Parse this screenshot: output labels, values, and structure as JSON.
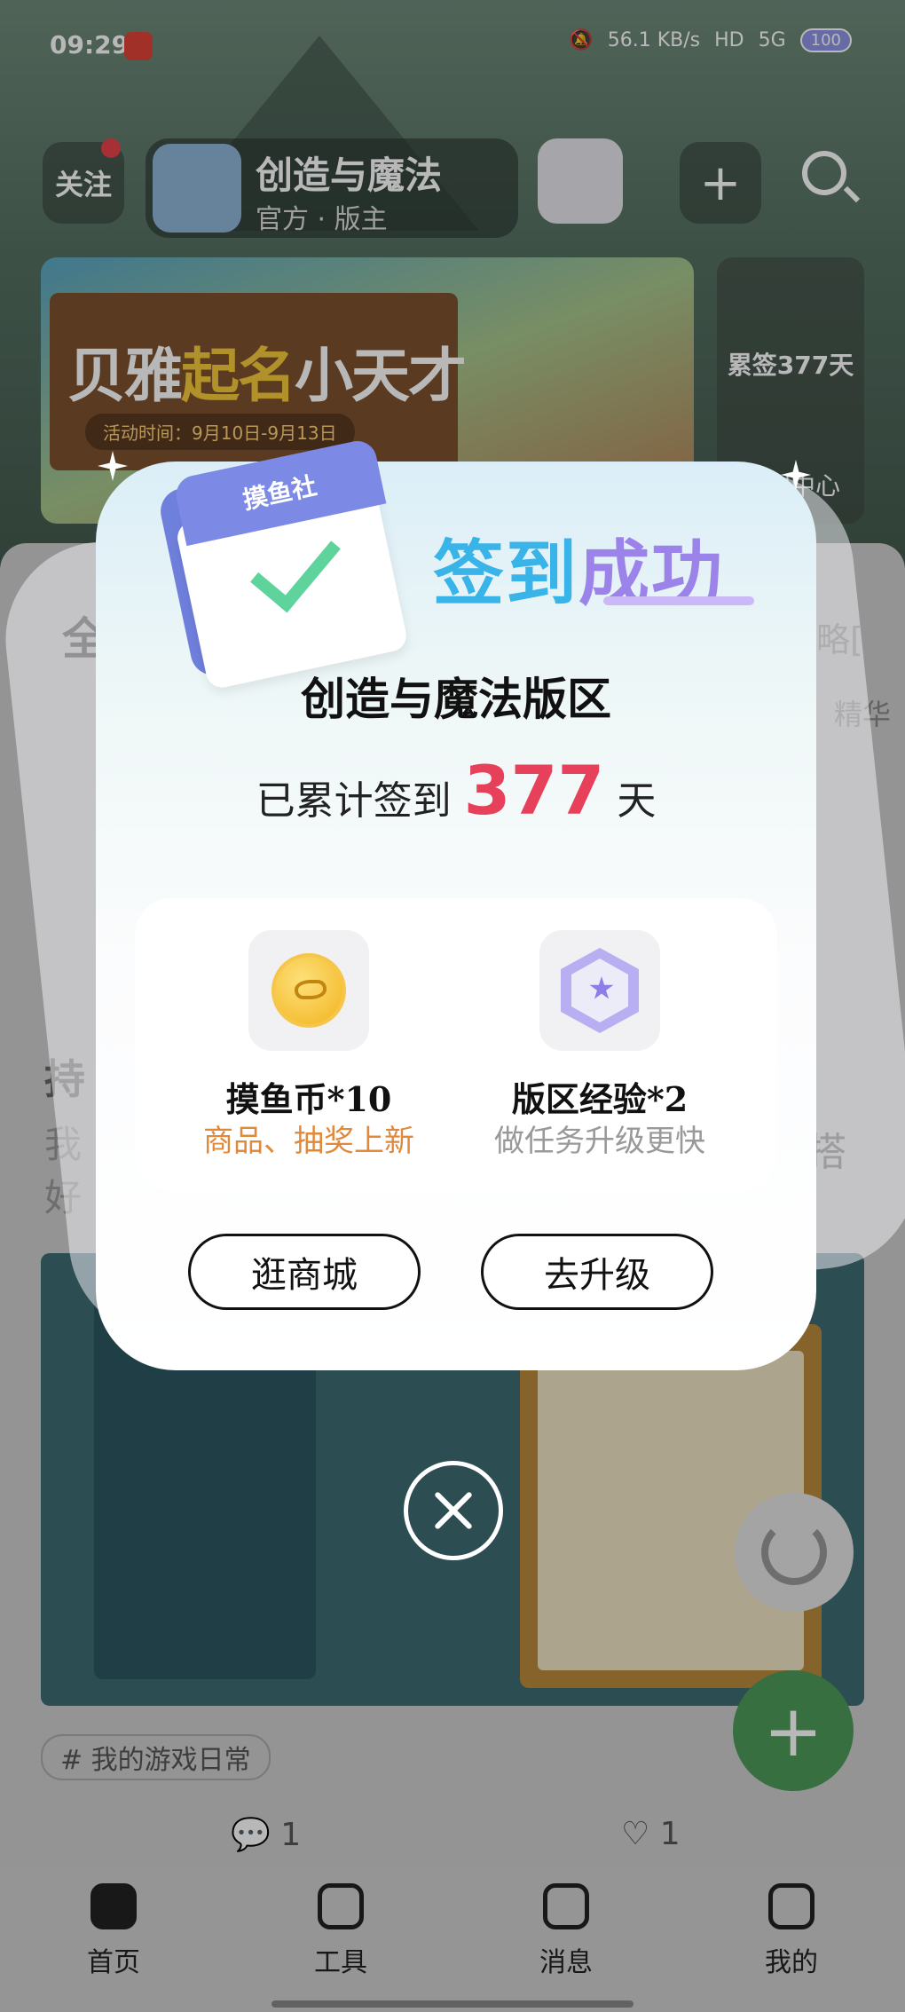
{
  "status_bar": {
    "time": "09:29",
    "net_speed": "56.1 KB/s",
    "hd": "HD",
    "network": "5G",
    "battery": "100"
  },
  "header": {
    "follow_label": "关注",
    "forum_name": "创造与魔法",
    "forum_sub": "官方 · 版主"
  },
  "banner": {
    "title_part1": "贝雅",
    "title_highlight": "起名",
    "title_part2": "小天才",
    "date": "活动时间：9月10日-9月13日"
  },
  "checkin_side": {
    "streak_label": "累签377天",
    "welfare_label": "福利中心"
  },
  "background_text": {
    "left_heading": "全",
    "right_heading": "略[",
    "right_sub": "精华",
    "post_title_fragment": "持",
    "post_body_1": "我",
    "post_body_2": "好",
    "post_right": "搭"
  },
  "post": {
    "tag": "# 我的游戏日常",
    "comments": "1",
    "likes": "1"
  },
  "modal": {
    "calendar_label": "摸鱼社",
    "success_title_1": "签到",
    "success_title_2": "成功",
    "forum_title": "创造与魔法版区",
    "streak_prefix": "已累计签到",
    "streak_days": "377",
    "streak_suffix": "天",
    "rewards": [
      {
        "name": "摸鱼币*10",
        "desc": "商品、抽奖上新",
        "desc_color": "#e0893a",
        "icon": "coin-icon"
      },
      {
        "name": "版区经验*2",
        "desc": "做任务升级更快",
        "desc_color": "#999999",
        "icon": "level-badge-icon"
      }
    ],
    "button_mall": "逛商城",
    "button_upgrade": "去升级"
  },
  "bottom_nav": [
    {
      "label": "首页",
      "icon": "home-icon"
    },
    {
      "label": "工具",
      "icon": "tools-icon"
    },
    {
      "label": "消息",
      "icon": "message-icon"
    },
    {
      "label": "我的",
      "icon": "profile-icon"
    }
  ]
}
